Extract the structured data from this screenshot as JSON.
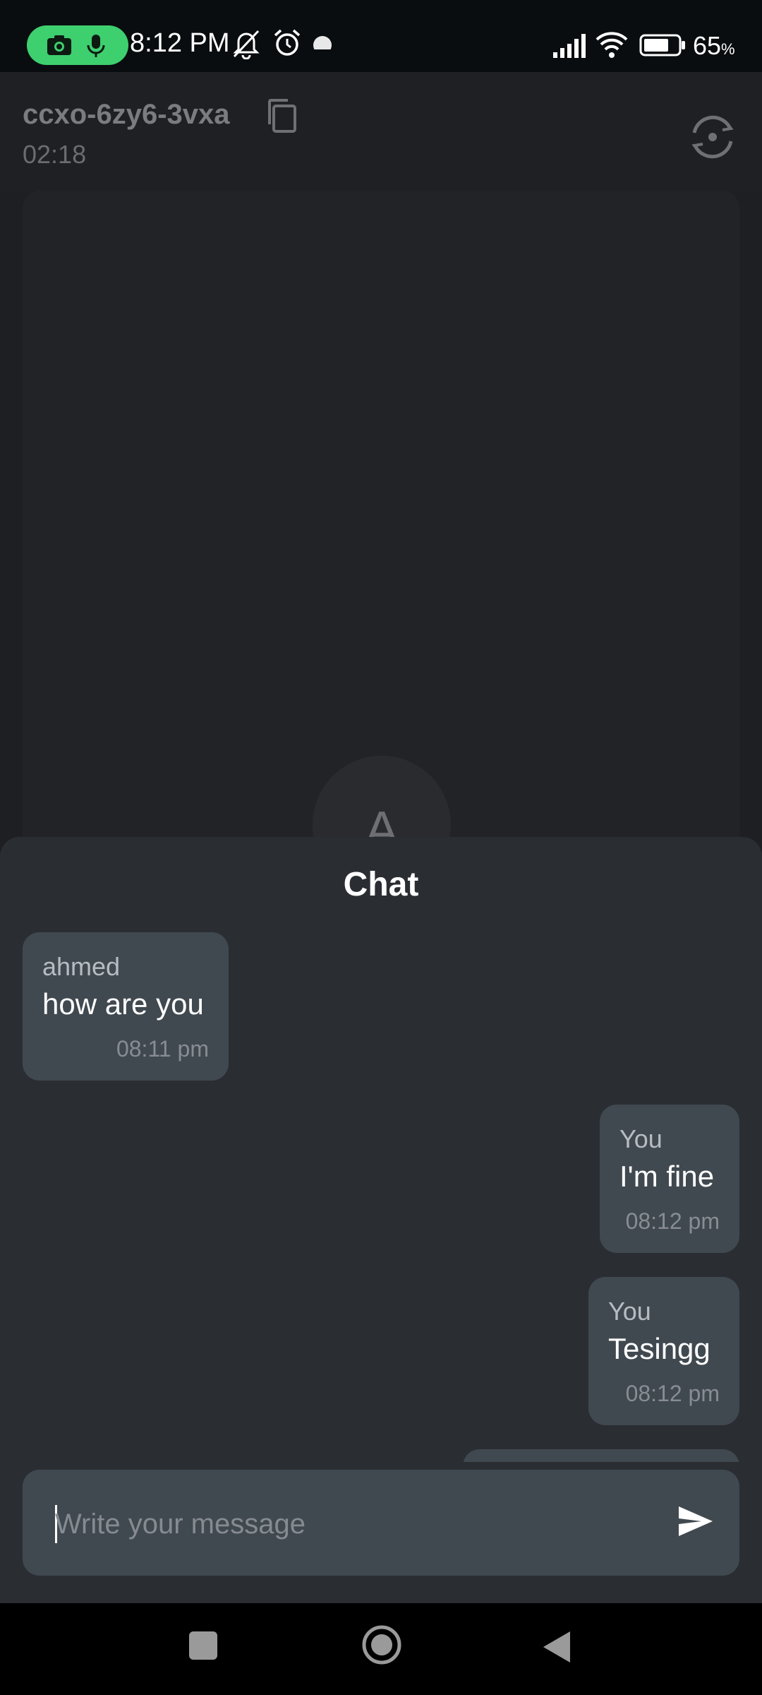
{
  "status_bar": {
    "time": "8:12 PM",
    "battery_pct": "65",
    "battery_pct_suffix": "%",
    "icons": [
      "camera-icon",
      "mic-icon",
      "mute-icon",
      "alarm-icon",
      "dot-icon",
      "signal-icon",
      "wifi-icon",
      "battery-icon"
    ]
  },
  "header": {
    "room_code": "ccxo-6zy6-3vxa",
    "timer": "02:18"
  },
  "video": {
    "avatar_initial": "A"
  },
  "chat": {
    "title": "Chat",
    "messages": [
      {
        "sender": "ahmed",
        "text": "how are you",
        "time": "08:11 pm",
        "side": "left"
      },
      {
        "sender": "You",
        "text": "I'm fine",
        "time": "08:12 pm",
        "side": "right"
      },
      {
        "sender": "You",
        "text": "Tesingg",
        "time": "08:12 pm",
        "side": "right"
      }
    ],
    "input_placeholder": "Write your message"
  },
  "colors": {
    "accent_green": "#3ecf6f",
    "sheet_bg": "#2a2e33",
    "bubble_bg": "#414950"
  }
}
